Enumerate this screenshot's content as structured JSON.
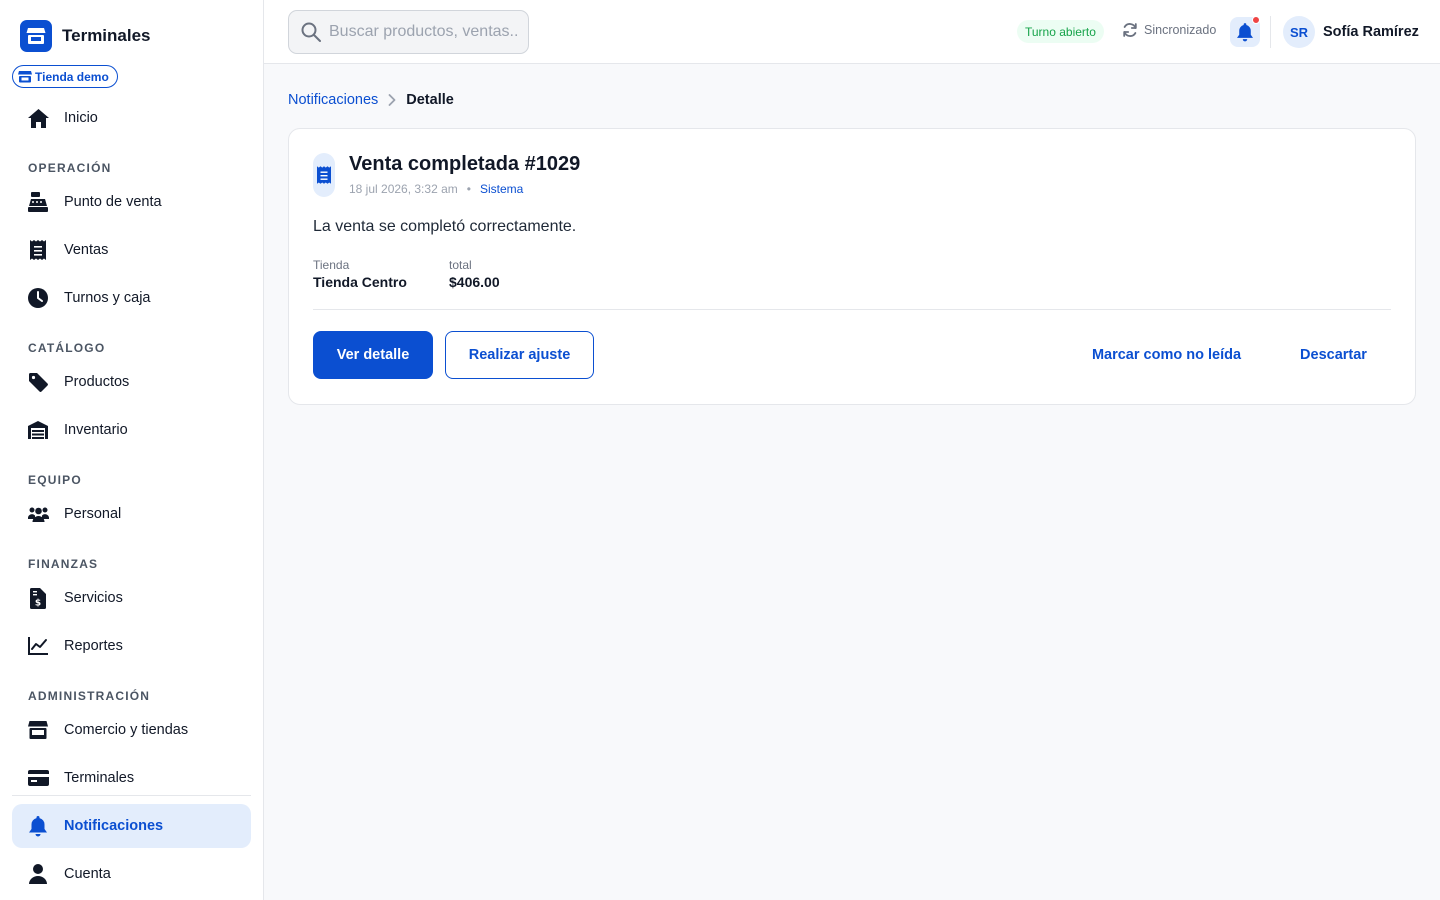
{
  "brand": {
    "name": "Terminales"
  },
  "store_selector": {
    "label": "Tienda demo"
  },
  "sidebar": {
    "home": {
      "label": "Inicio",
      "icon": "home-icon"
    },
    "sections": [
      {
        "title": "OPERACIÓN",
        "items": [
          {
            "label": "Punto de venta",
            "icon": "cash-register-icon"
          },
          {
            "label": "Ventas",
            "icon": "receipt-icon"
          },
          {
            "label": "Turnos y caja",
            "icon": "clock-icon"
          }
        ]
      },
      {
        "title": "CATÁLOGO",
        "items": [
          {
            "label": "Productos",
            "icon": "tag-icon"
          },
          {
            "label": "Inventario",
            "icon": "warehouse-icon"
          }
        ]
      },
      {
        "title": "EQUIPO",
        "items": [
          {
            "label": "Personal",
            "icon": "users-icon"
          }
        ]
      },
      {
        "title": "FINANZAS",
        "items": [
          {
            "label": "Servicios",
            "icon": "invoice-dollar-icon"
          },
          {
            "label": "Reportes",
            "icon": "chart-line-icon"
          }
        ]
      },
      {
        "title": "ADMINISTRACIÓN",
        "items": [
          {
            "label": "Comercio y tiendas",
            "icon": "store-icon"
          },
          {
            "label": "Terminales",
            "icon": "credit-card-icon"
          }
        ]
      }
    ],
    "bottom": [
      {
        "label": "Notificaciones",
        "icon": "bell-icon",
        "active": true
      },
      {
        "label": "Cuenta",
        "icon": "user-icon"
      }
    ]
  },
  "topbar": {
    "search_placeholder": "Buscar productos, ventas...",
    "shift_status": "Turno abierto",
    "sync_status": "Sincronizado",
    "user": {
      "initials": "SR",
      "name": "Sofía Ramírez"
    }
  },
  "breadcrumb": {
    "parent": "Notificaciones",
    "current": "Detalle"
  },
  "notification": {
    "title": "Venta completada #1029",
    "timestamp": "18 jul 2026, 3:32 am",
    "separator": "•",
    "source": "Sistema",
    "message": "La venta se completó correctamente.",
    "fields": [
      {
        "label": "Tienda",
        "value": "Tienda Centro"
      },
      {
        "label": "total",
        "value": "$406.00"
      }
    ],
    "actions": {
      "view": "Ver detalle",
      "adjust": "Realizar ajuste",
      "mark_unread": "Marcar como no leída",
      "dismiss": "Descartar"
    }
  },
  "colors": {
    "primary": "#0b4fd1",
    "active_bg": "#e3edfc",
    "success": "#16a34a",
    "alert": "#ef4444"
  }
}
